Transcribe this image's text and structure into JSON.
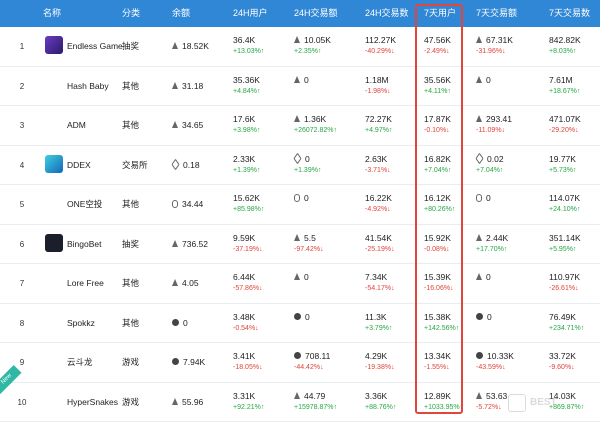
{
  "headers": [
    "名称",
    "分类",
    "余额",
    "24H用户",
    "24H交易额",
    "24H交易数",
    "7天用户",
    "7天交易额",
    "7天交易数"
  ],
  "rows": [
    {
      "rank": "1",
      "name": "Endless Game",
      "category": "抽奖",
      "chain": "eth",
      "balance": "18.52K",
      "u24": "36.4K",
      "u24c": "+13.03%↑",
      "u24d": "up",
      "v24": "10.05K",
      "v24c": "+2.35%↑",
      "v24d": "up",
      "v24i": "eth",
      "t24": "112.27K",
      "t24c": "-40.29%↓",
      "t24d": "down",
      "u7": "47.56K",
      "u7c": "-2.49%↓",
      "u7d": "down",
      "v7": "67.31K",
      "v7c": "-31.96%↓",
      "v7d": "down",
      "v7i": "eth",
      "t7": "842.82K",
      "t7c": "+8.03%↑",
      "t7d": "up"
    },
    {
      "rank": "2",
      "name": "Hash Baby",
      "category": "其他",
      "chain": "eth",
      "balance": "31.18",
      "u24": "35.36K",
      "u24c": "+4.84%↑",
      "u24d": "up",
      "v24": "0",
      "v24c": "",
      "v24d": "neutral",
      "v24i": "eth",
      "t24": "1.18M",
      "t24c": "-1.98%↓",
      "t24d": "down",
      "u7": "35.56K",
      "u7c": "+4.11%↑",
      "u7d": "up",
      "v7": "0",
      "v7c": "",
      "v7d": "neutral",
      "v7i": "eth",
      "t7": "7.61M",
      "t7c": "+18.67%↑",
      "t7d": "up"
    },
    {
      "rank": "3",
      "name": "ADM",
      "category": "其他",
      "chain": "eth",
      "balance": "34.65",
      "u24": "17.6K",
      "u24c": "+3.98%↑",
      "u24d": "up",
      "v24": "1.36K",
      "v24c": "+26072.82%↑",
      "v24d": "up",
      "v24i": "eth",
      "t24": "72.27K",
      "t24c": "+4.97%↑",
      "t24d": "up",
      "u7": "17.87K",
      "u7c": "-0.10%↓",
      "u7d": "down",
      "v7": "293.41",
      "v7c": "-11.09%↓",
      "v7d": "down",
      "v7i": "eth",
      "t7": "471.07K",
      "t7c": "-29.20%↓",
      "t7d": "down"
    },
    {
      "rank": "4",
      "name": "DDEX",
      "category": "交易所",
      "chain": "tron",
      "balance": "0.18",
      "u24": "2.33K",
      "u24c": "+1.39%↑",
      "u24d": "up",
      "v24": "0",
      "v24c": "+1.39%↑",
      "v24d": "up",
      "v24i": "tron",
      "t24": "2.63K",
      "t24c": "-3.71%↓",
      "t24d": "down",
      "u7": "16.82K",
      "u7c": "+7.04%↑",
      "u7d": "up",
      "v7": "0.02",
      "v7c": "+7.04%↑",
      "v7d": "up",
      "v7i": "tron",
      "t7": "19.77K",
      "t7c": "+5.73%↑",
      "t7d": "up"
    },
    {
      "rank": "5",
      "name": "ONE空投",
      "category": "其他",
      "chain": "eos",
      "balance": "34.44",
      "u24": "15.62K",
      "u24c": "+85.98%↑",
      "u24d": "up",
      "v24": "0",
      "v24c": "",
      "v24d": "neutral",
      "v24i": "eos",
      "t24": "16.22K",
      "t24c": "-4.92%↓",
      "t24d": "down",
      "u7": "16.12K",
      "u7c": "+80.26%↑",
      "u7d": "up",
      "v7": "0",
      "v7c": "",
      "v7d": "neutral",
      "v7i": "eos",
      "t7": "114.07K",
      "t7c": "+24.10%↑",
      "t7d": "up"
    },
    {
      "rank": "6",
      "name": "BingoBet",
      "category": "抽奖",
      "chain": "eth",
      "balance": "736.52",
      "u24": "9.59K",
      "u24c": "-37.19%↓",
      "u24d": "down",
      "v24": "5.5",
      "v24c": "-97.42%↓",
      "v24d": "down",
      "v24i": "eth",
      "t24": "41.54K",
      "t24c": "-25.19%↓",
      "t24d": "down",
      "u7": "15.92K",
      "u7c": "-0.08%↓",
      "u7d": "down",
      "v7": "2.44K",
      "v7c": "+17.70%↑",
      "v7d": "up",
      "v7i": "eth",
      "t7": "351.14K",
      "t7c": "+5.95%↑",
      "t7d": "up"
    },
    {
      "rank": "7",
      "name": "Lore Free",
      "category": "其他",
      "chain": "eth",
      "balance": "4.05",
      "u24": "6.44K",
      "u24c": "-57.86%↓",
      "u24d": "down",
      "v24": "0",
      "v24c": "",
      "v24d": "neutral",
      "v24i": "eth",
      "t24": "7.34K",
      "t24c": "-54.17%↓",
      "t24d": "down",
      "u7": "15.39K",
      "u7c": "-16.06%↓",
      "u7d": "down",
      "v7": "0",
      "v7c": "",
      "v7d": "neutral",
      "v7i": "eth",
      "t7": "110.97K",
      "t7c": "-26.61%↓",
      "t7d": "down"
    },
    {
      "rank": "8",
      "name": "Spokkz",
      "category": "其他",
      "chain": "ont",
      "balance": "0",
      "u24": "3.48K",
      "u24c": "-0.54%↓",
      "u24d": "down",
      "v24": "0",
      "v24c": "",
      "v24d": "neutral",
      "v24i": "ont",
      "t24": "11.3K",
      "t24c": "+3.79%↑",
      "t24d": "up",
      "u7": "15.38K",
      "u7c": "+142.56%↑",
      "u7d": "up",
      "v7": "0",
      "v7c": "",
      "v7d": "neutral",
      "v7i": "ont",
      "t7": "76.49K",
      "t7c": "+234.71%↑",
      "t7d": "up"
    },
    {
      "rank": "9",
      "name": "云斗龙",
      "category": "游戏",
      "chain": "ont",
      "balance": "7.94K",
      "u24": "3.41K",
      "u24c": "-18.05%↓",
      "u24d": "down",
      "v24": "708.11",
      "v24c": "-44.42%↓",
      "v24d": "down",
      "v24i": "ont",
      "t24": "4.29K",
      "t24c": "-19.38%↓",
      "t24d": "down",
      "u7": "13.34K",
      "u7c": "-1.55%↓",
      "u7d": "down",
      "v7": "10.33K",
      "v7c": "-43.59%↓",
      "v7d": "down",
      "v7i": "ont",
      "t7": "33.72K",
      "t7c": "-9.60%↓",
      "t7d": "down"
    },
    {
      "rank": "10",
      "name": "HyperSnakes",
      "category": "游戏",
      "chain": "eth",
      "balance": "55.96",
      "u24": "3.31K",
      "u24c": "+92.21%↑",
      "u24d": "up",
      "v24": "44.79",
      "v24c": "+15978.87%↑",
      "v24d": "up",
      "v24i": "eth",
      "t24": "3.36K",
      "t24c": "+88.76%↑",
      "t24d": "up",
      "u7": "12.89K",
      "u7c": "+1033.95%↑",
      "u7d": "up",
      "v7": "53.63",
      "v7c": "-5.72%↓",
      "v7d": "down",
      "v7i": "eth",
      "t7": "14.03K",
      "t7c": "+869.87%↑",
      "t7d": "up"
    }
  ],
  "new_badge": "New",
  "watermark": "BEST",
  "colors": {
    "header": "#2f87d6",
    "up": "#27a644",
    "down": "#e0443b",
    "highlight": "#e2463b"
  }
}
